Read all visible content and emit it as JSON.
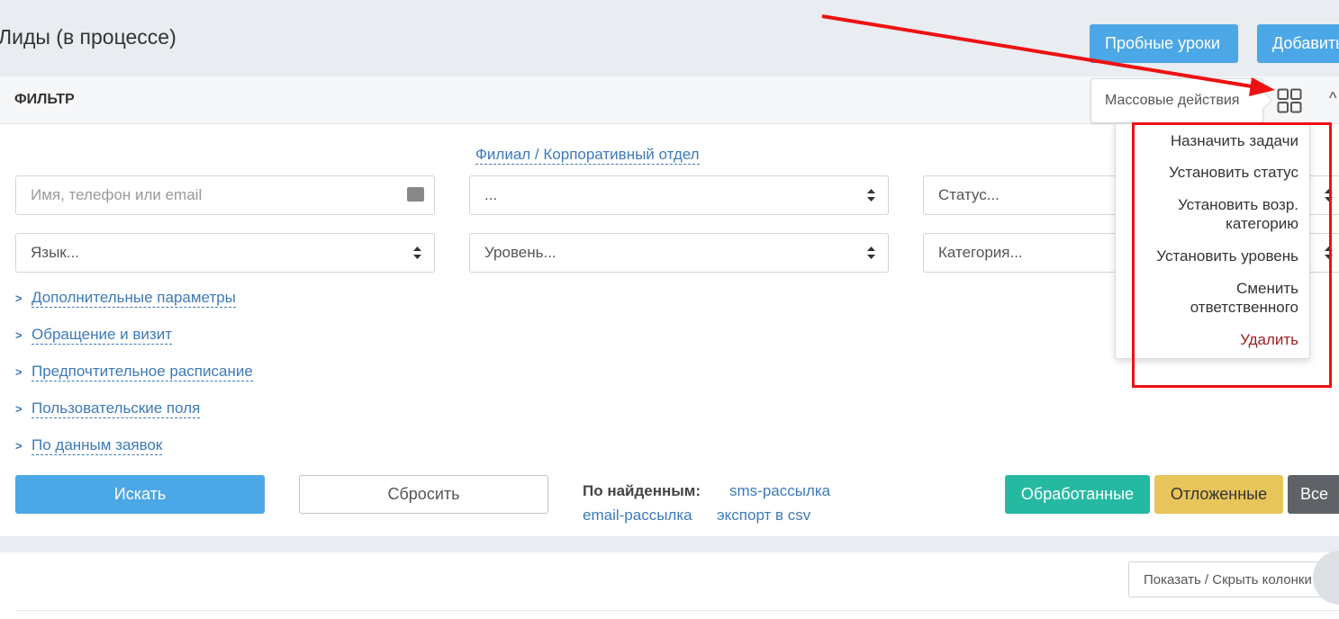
{
  "page": {
    "title": "Лиды (в процессе)"
  },
  "header_buttons": {
    "trial": "Пробные уроки",
    "add": "Добавить"
  },
  "filter": {
    "title": "ФИЛЬТР",
    "mass_actions_label": "Массовые действия",
    "branch_link": "Филиал / Корпоративный отдел",
    "fields": {
      "search": {
        "placeholder": "Имя, телефон или email"
      },
      "branch": {
        "value": "..."
      },
      "status": {
        "value": "Статус..."
      },
      "language": {
        "value": "Язык..."
      },
      "level": {
        "value": "Уровень..."
      },
      "category": {
        "value": "Категория..."
      }
    },
    "sections": [
      "Дополнительные параметры",
      "Обращение и визит",
      "Предпочтительное расписание",
      "Пользовательские поля",
      "По данным заявок"
    ],
    "search_button": "Искать",
    "reset_button": "Сбросить",
    "found": {
      "label": "По найденным:",
      "sms": "sms-рассылка",
      "email": "email-рассылка",
      "csv": "экспорт в csv"
    },
    "status_buttons": {
      "done": "Обработанные",
      "delayed": "Отложенные",
      "all": "Все"
    }
  },
  "mass_actions_menu": [
    {
      "line1": "Назначить задачи",
      "line2": ""
    },
    {
      "line1": "Установить статус",
      "line2": ""
    },
    {
      "line1": "Установить возр.",
      "line2": "категорию"
    },
    {
      "line1": "Установить уровень",
      "line2": ""
    },
    {
      "line1": "Сменить",
      "line2": "ответственного"
    },
    {
      "line1": "Удалить",
      "line2": ""
    }
  ],
  "table": {
    "columns_button": "Показать / Скрыть колонки"
  },
  "colors": {
    "primary": "#4ca7e6",
    "success": "#26b9a2",
    "warning": "#e8c55a",
    "dark": "#5f6266",
    "link": "#3d7ab8",
    "danger": "#a11f1f",
    "highlight": "#ee1111"
  }
}
